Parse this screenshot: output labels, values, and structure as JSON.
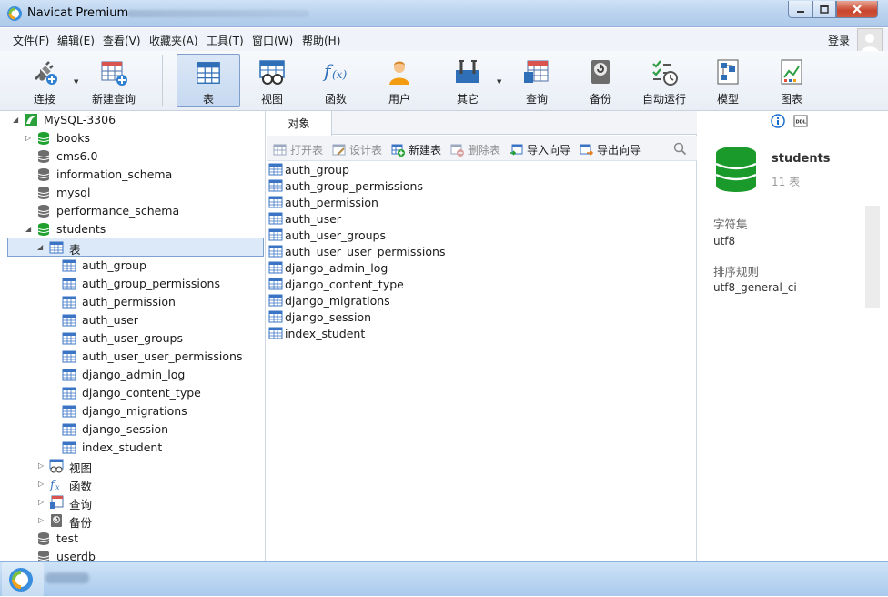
{
  "window": {
    "title": "Navicat Premium"
  },
  "menu": {
    "items": [
      "文件(F)",
      "编辑(E)",
      "查看(V)",
      "收藏夹(A)",
      "工具(T)",
      "窗口(W)",
      "帮助(H)"
    ],
    "login": "登录"
  },
  "toolbar": {
    "buttons": [
      {
        "label": "连接",
        "icon": "plug-icon"
      },
      {
        "label": "新建查询",
        "icon": "new-query-icon"
      },
      {
        "label": "表",
        "icon": "table-icon"
      },
      {
        "label": "视图",
        "icon": "view-icon"
      },
      {
        "label": "函数",
        "icon": "function-icon"
      },
      {
        "label": "用户",
        "icon": "user-icon"
      },
      {
        "label": "其它",
        "icon": "tools-icon"
      },
      {
        "label": "查询",
        "icon": "query-icon"
      },
      {
        "label": "备份",
        "icon": "backup-icon"
      },
      {
        "label": "自动运行",
        "icon": "autorun-icon"
      },
      {
        "label": "模型",
        "icon": "model-icon"
      },
      {
        "label": "图表",
        "icon": "chart-icon"
      }
    ]
  },
  "tree": {
    "connection": "MySQL-3306",
    "databases": [
      "books",
      "cms6.0",
      "information_schema",
      "mysql",
      "performance_schema",
      "students"
    ],
    "students_children": {
      "tables_group": "表",
      "tables": [
        "auth_group",
        "auth_group_permissions",
        "auth_permission",
        "auth_user",
        "auth_user_groups",
        "auth_user_user_permissions",
        "django_admin_log",
        "django_content_type",
        "django_migrations",
        "django_session",
        "index_student"
      ],
      "views": "视图",
      "functions": "函数",
      "queries": "查询",
      "backups": "备份"
    },
    "more_databases": [
      "test",
      "userdb"
    ]
  },
  "objects": {
    "tab_label": "对象",
    "actions": [
      {
        "label": "打开表",
        "enabled": false
      },
      {
        "label": "设计表",
        "enabled": false
      },
      {
        "label": "新建表",
        "enabled": true
      },
      {
        "label": "删除表",
        "enabled": false
      },
      {
        "label": "导入向导",
        "enabled": true
      },
      {
        "label": "导出向导",
        "enabled": true
      }
    ],
    "list": [
      "auth_group",
      "auth_group_permissions",
      "auth_permission",
      "auth_user",
      "auth_user_groups",
      "auth_user_user_permissions",
      "django_admin_log",
      "django_content_type",
      "django_migrations",
      "django_session",
      "index_student"
    ]
  },
  "info": {
    "db_name": "students",
    "table_count": "11 表",
    "charset_label": "字符集",
    "charset_value": "utf8",
    "collation_label": "排序规则",
    "collation_value": "utf8_general_ci"
  },
  "colors": {
    "db_green": "#1fa12f",
    "db_gray": "#6d6d6d",
    "table_blue": "#3b74c4",
    "selection": "#dbe9f9"
  }
}
